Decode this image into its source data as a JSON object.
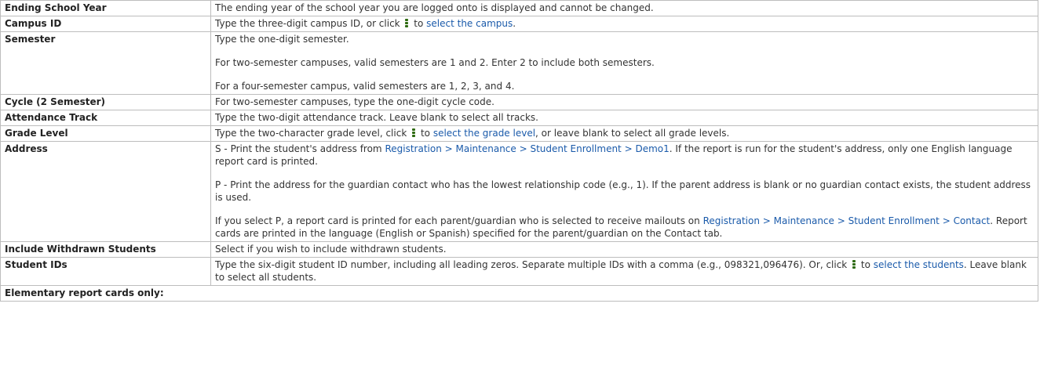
{
  "rows": [
    {
      "label": "Ending School Year",
      "text": "The ending year of the school year you are logged onto is displayed and cannot be changed."
    },
    {
      "label": "Campus ID",
      "pre": "Type the three-digit campus ID, or click",
      "mid": "to",
      "link": "select the campus",
      "post": "."
    },
    {
      "label": "Semester",
      "p1": "Type the one-digit semester.",
      "p2": "For two-semester campuses, valid semesters are 1 and 2. Enter 2 to include both semesters.",
      "p3": "For a four-semester campus, valid semesters are 1, 2, 3, and 4."
    },
    {
      "label": "Cycle (2 Semester)",
      "text": "For two-semester campuses, type the one-digit cycle code."
    },
    {
      "label": "Attendance Track",
      "text": "Type the two-digit attendance track. Leave blank to select all tracks."
    },
    {
      "label": "Grade Level",
      "pre": "Type the two-character grade level, click",
      "mid": "to",
      "link": "select the grade level",
      "post": ", or leave blank to select all grade levels."
    },
    {
      "label": "Address",
      "s_pre": "S - Print the student's address from",
      "s_link": "Registration > Maintenance > Student Enrollment > Demo1",
      "s_post": ". If the report is run for the student's address, only one English language report card is printed.",
      "p_text": "P - Print the address for the guardian contact who has the lowest relationship code (e.g., 1). If the parent address is blank or no guardian contact exists, the student address is used.",
      "sel_pre": "If you select P, a report card is printed for each parent/guardian who is selected to receive mailouts on",
      "sel_link": "Registration > Maintenance > Student Enrollment > Contact",
      "sel_post": ". Report cards are printed in the language (English or Spanish) specified for the parent/guardian on the Contact tab."
    },
    {
      "label": "Include Withdrawn Students",
      "text": "Select if you wish to include withdrawn students."
    },
    {
      "label": "Student IDs",
      "pre": "Type the six-digit student ID number, including all leading zeros. Separate multiple IDs with a comma (e.g., 098321,096476). Or, click",
      "mid": "to",
      "link": "select the students",
      "post": ". Leave blank to select all students."
    }
  ],
  "section": "Elementary report cards only:",
  "icons": {
    "lookup": "vertical-dots-icon",
    "lookup_color": "#2d6a0f"
  },
  "colors": {
    "link": "#1a5aaa",
    "border": "#bdbdbd"
  }
}
